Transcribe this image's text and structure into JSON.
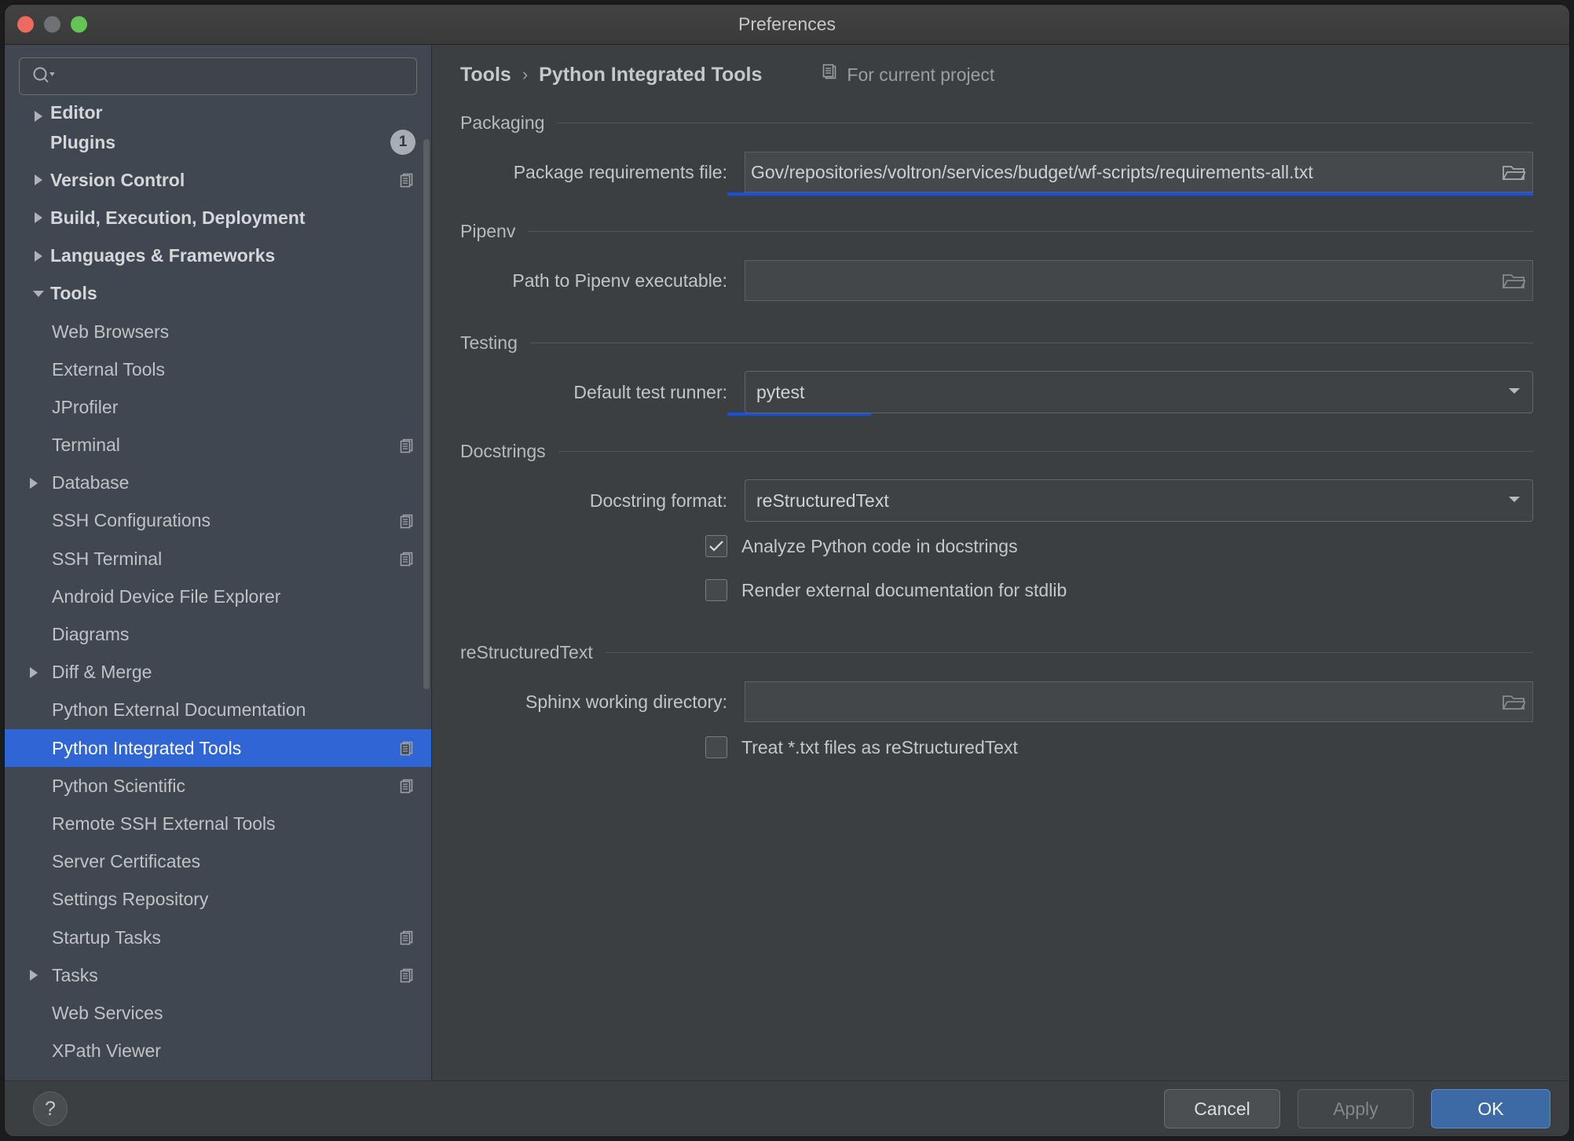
{
  "window": {
    "title": "Preferences",
    "traffic_lights": [
      "close",
      "minimize",
      "maximize"
    ]
  },
  "search": {
    "value": "",
    "placeholder": "",
    "icon": "search-icon"
  },
  "sidebar": {
    "scrolled_partial_item": "Editor",
    "items": [
      {
        "label": "Plugins",
        "level": 0,
        "bold": true,
        "arrow": "none",
        "badge": "1",
        "copy": false
      },
      {
        "label": "Version Control",
        "level": 0,
        "bold": true,
        "arrow": "collapsed",
        "badge": null,
        "copy": true
      },
      {
        "label": "Build, Execution, Deployment",
        "level": 0,
        "bold": true,
        "arrow": "collapsed",
        "badge": null,
        "copy": false
      },
      {
        "label": "Languages & Frameworks",
        "level": 0,
        "bold": true,
        "arrow": "collapsed",
        "badge": null,
        "copy": false
      },
      {
        "label": "Tools",
        "level": 0,
        "bold": true,
        "arrow": "expanded",
        "badge": null,
        "copy": false
      },
      {
        "label": "Web Browsers",
        "level": 1,
        "bold": false,
        "arrow": "none",
        "badge": null,
        "copy": false
      },
      {
        "label": "External Tools",
        "level": 1,
        "bold": false,
        "arrow": "none",
        "badge": null,
        "copy": false
      },
      {
        "label": "JProfiler",
        "level": 1,
        "bold": false,
        "arrow": "none",
        "badge": null,
        "copy": false
      },
      {
        "label": "Terminal",
        "level": 1,
        "bold": false,
        "arrow": "none",
        "badge": null,
        "copy": true
      },
      {
        "label": "Database",
        "level": 1,
        "bold": false,
        "arrow": "collapsed",
        "badge": null,
        "copy": false
      },
      {
        "label": "SSH Configurations",
        "level": 1,
        "bold": false,
        "arrow": "none",
        "badge": null,
        "copy": true
      },
      {
        "label": "SSH Terminal",
        "level": 1,
        "bold": false,
        "arrow": "none",
        "badge": null,
        "copy": true
      },
      {
        "label": "Android Device File Explorer",
        "level": 1,
        "bold": false,
        "arrow": "none",
        "badge": null,
        "copy": false
      },
      {
        "label": "Diagrams",
        "level": 1,
        "bold": false,
        "arrow": "none",
        "badge": null,
        "copy": false
      },
      {
        "label": "Diff & Merge",
        "level": 1,
        "bold": false,
        "arrow": "collapsed",
        "badge": null,
        "copy": false
      },
      {
        "label": "Python External Documentation",
        "level": 1,
        "bold": false,
        "arrow": "none",
        "badge": null,
        "copy": false
      },
      {
        "label": "Python Integrated Tools",
        "level": 1,
        "bold": false,
        "arrow": "none",
        "badge": null,
        "copy": true,
        "selected": true
      },
      {
        "label": "Python Scientific",
        "level": 1,
        "bold": false,
        "arrow": "none",
        "badge": null,
        "copy": true
      },
      {
        "label": "Remote SSH External Tools",
        "level": 1,
        "bold": false,
        "arrow": "none",
        "badge": null,
        "copy": false
      },
      {
        "label": "Server Certificates",
        "level": 1,
        "bold": false,
        "arrow": "none",
        "badge": null,
        "copy": false
      },
      {
        "label": "Settings Repository",
        "level": 1,
        "bold": false,
        "arrow": "none",
        "badge": null,
        "copy": false
      },
      {
        "label": "Startup Tasks",
        "level": 1,
        "bold": false,
        "arrow": "none",
        "badge": null,
        "copy": true
      },
      {
        "label": "Tasks",
        "level": 1,
        "bold": false,
        "arrow": "collapsed",
        "badge": null,
        "copy": true
      },
      {
        "label": "Web Services",
        "level": 1,
        "bold": false,
        "arrow": "none",
        "badge": null,
        "copy": false
      },
      {
        "label": "XPath Viewer",
        "level": 1,
        "bold": false,
        "arrow": "none",
        "badge": null,
        "copy": false
      }
    ]
  },
  "breadcrumb": {
    "parent": "Tools",
    "separator": "›",
    "current": "Python Integrated Tools",
    "scope_label": "For current project",
    "scope_icon": "project-scope-icon"
  },
  "sections": {
    "packaging": {
      "title": "Packaging",
      "requirements": {
        "label": "Package requirements file:",
        "value": "Gov/repositories/voltron/services/budget/wf-scripts/requirements-all.txt",
        "browse_icon": "folder-icon",
        "modified": true
      }
    },
    "pipenv": {
      "title": "Pipenv",
      "path": {
        "label": "Path to Pipenv executable:",
        "value": "",
        "browse_icon": "folder-icon",
        "modified": false
      }
    },
    "testing": {
      "title": "Testing",
      "runner": {
        "label": "Default test runner:",
        "value": "pytest",
        "dropdown_icon": "chevron-down-icon",
        "modified": true
      }
    },
    "docstrings": {
      "title": "Docstrings",
      "format": {
        "label": "Docstring format:",
        "value": "reStructuredText",
        "dropdown_icon": "chevron-down-icon",
        "modified": false
      },
      "checkboxes": [
        {
          "label": "Analyze Python code in docstrings",
          "checked": true
        },
        {
          "label": "Render external documentation for stdlib",
          "checked": false
        }
      ]
    },
    "restructuredtext": {
      "title": "reStructuredText",
      "sphinx": {
        "label": "Sphinx working directory:",
        "value": "",
        "browse_icon": "folder-icon",
        "modified": false
      },
      "checkbox": {
        "label": "Treat *.txt files as reStructuredText",
        "checked": false
      }
    }
  },
  "footer": {
    "help_label": "?",
    "cancel_label": "Cancel",
    "apply_label": "Apply",
    "ok_label": "OK"
  },
  "colors": {
    "selection_blue": "#2f65d4",
    "modified_underline": "#1a4fe0",
    "ok_button": "#3d6aa5",
    "panel_bg": "#3c3f41",
    "sidebar_bg": "#414750"
  }
}
